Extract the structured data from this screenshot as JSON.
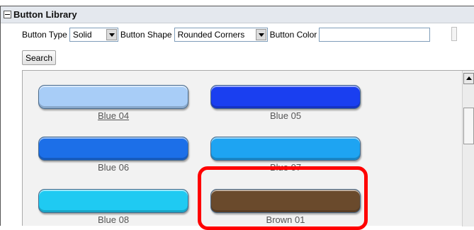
{
  "panel": {
    "title": "Button Library",
    "collapse_icon": "collapse-minus-icon"
  },
  "filters": {
    "button_type_label": "Button Type",
    "button_type_value": "Solid",
    "button_shape_label": "Button Shape",
    "button_shape_value": "Rounded Corners",
    "button_color_label": "Button Color",
    "button_color_value": "",
    "search_label": "Search"
  },
  "buttons": [
    {
      "label": "Blue 04",
      "color": "#a8cdf7",
      "link": true
    },
    {
      "label": "Blue 05",
      "color": "#1a3ff0",
      "link": false
    },
    {
      "label": "Blue 06",
      "color": "#1c6fe8",
      "link": false
    },
    {
      "label": "Blue 07",
      "color": "#1ea4f2",
      "link": false
    },
    {
      "label": "Blue 08",
      "color": "#1fcaf2",
      "link": false
    },
    {
      "label": "Brown 01",
      "color": "#6a4a2c",
      "link": false
    }
  ],
  "highlight_color": "#ff0000"
}
